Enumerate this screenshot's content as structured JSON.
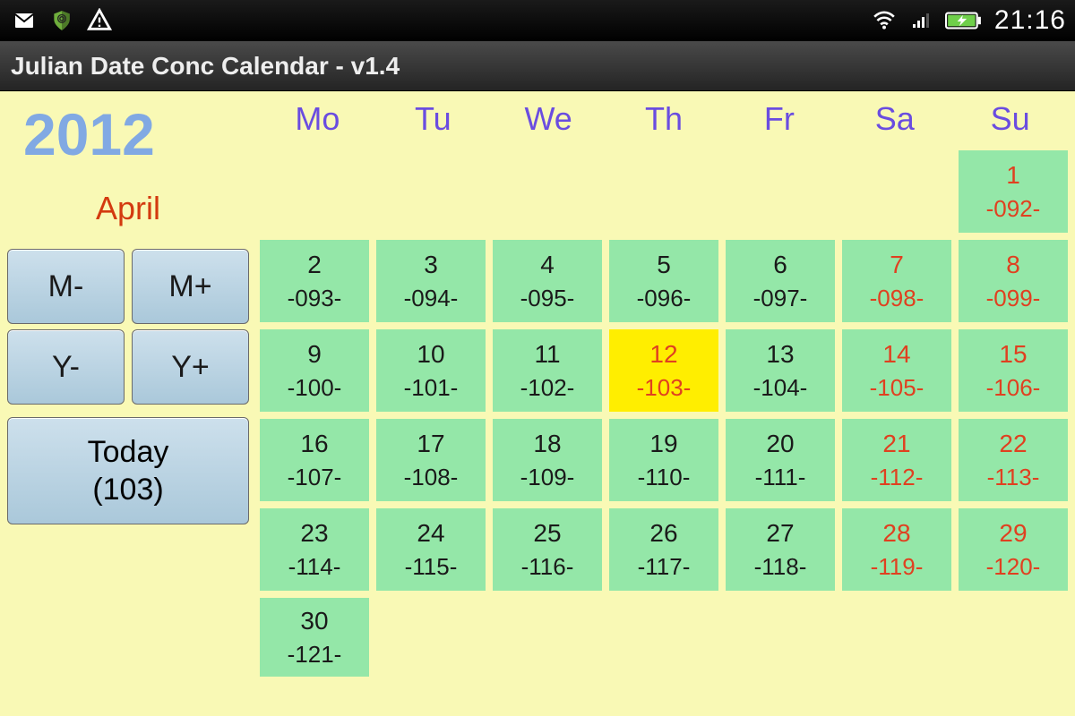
{
  "status": {
    "time": "21:16"
  },
  "title": "Julian Date Conc Calendar - v1.4",
  "sidebar": {
    "year": "2012",
    "month": "April",
    "btn_m_minus": "M-",
    "btn_m_plus": "M+",
    "btn_y_minus": "Y-",
    "btn_y_plus": "Y+",
    "btn_today_line1": "Today",
    "btn_today_line2": "(103)"
  },
  "calendar": {
    "weekdays": [
      "Mo",
      "Tu",
      "We",
      "Th",
      "Fr",
      "Sa",
      "Su"
    ],
    "weeks": [
      [
        null,
        null,
        null,
        null,
        null,
        null,
        {
          "d": "1",
          "j": "-092-",
          "weekend": true
        }
      ],
      [
        {
          "d": "2",
          "j": "-093-"
        },
        {
          "d": "3",
          "j": "-094-"
        },
        {
          "d": "4",
          "j": "-095-"
        },
        {
          "d": "5",
          "j": "-096-"
        },
        {
          "d": "6",
          "j": "-097-"
        },
        {
          "d": "7",
          "j": "-098-",
          "weekend": true
        },
        {
          "d": "8",
          "j": "-099-",
          "weekend": true
        }
      ],
      [
        {
          "d": "9",
          "j": "-100-"
        },
        {
          "d": "10",
          "j": "-101-"
        },
        {
          "d": "11",
          "j": "-102-"
        },
        {
          "d": "12",
          "j": "-103-",
          "today": true
        },
        {
          "d": "13",
          "j": "-104-"
        },
        {
          "d": "14",
          "j": "-105-",
          "weekend": true
        },
        {
          "d": "15",
          "j": "-106-",
          "weekend": true
        }
      ],
      [
        {
          "d": "16",
          "j": "-107-"
        },
        {
          "d": "17",
          "j": "-108-"
        },
        {
          "d": "18",
          "j": "-109-"
        },
        {
          "d": "19",
          "j": "-110-"
        },
        {
          "d": "20",
          "j": "-111-"
        },
        {
          "d": "21",
          "j": "-112-",
          "weekend": true
        },
        {
          "d": "22",
          "j": "-113-",
          "weekend": true
        }
      ],
      [
        {
          "d": "23",
          "j": "-114-"
        },
        {
          "d": "24",
          "j": "-115-"
        },
        {
          "d": "25",
          "j": "-116-"
        },
        {
          "d": "26",
          "j": "-117-"
        },
        {
          "d": "27",
          "j": "-118-"
        },
        {
          "d": "28",
          "j": "-119-",
          "weekend": true
        },
        {
          "d": "29",
          "j": "-120-",
          "weekend": true
        }
      ],
      [
        {
          "d": "30",
          "j": "-121-"
        },
        null,
        null,
        null,
        null,
        null,
        null
      ]
    ]
  }
}
